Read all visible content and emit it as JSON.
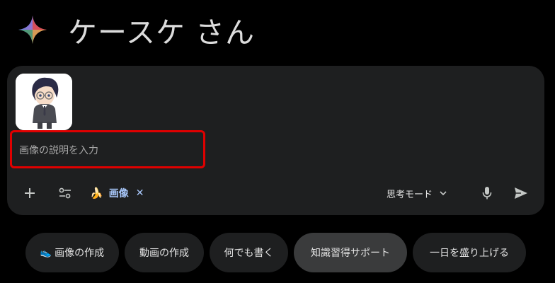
{
  "greeting": {
    "name": "ケースケ さん",
    "icon": "gemini-sparkle-icon"
  },
  "composer": {
    "attachment": {
      "icon": "anime-character-thumbnail"
    },
    "prompt": {
      "placeholder": "画像の説明を入力",
      "value": ""
    },
    "toolbar": {
      "add_icon": "plus-icon",
      "tools_icon": "tune-icon",
      "chip": {
        "emoji": "🍌",
        "label": "画像",
        "close": "✕"
      },
      "mode_label": "思考モード",
      "mode_icon": "chevron-down-icon",
      "mic_icon": "mic-icon",
      "send_icon": "send-icon"
    }
  },
  "suggestions": [
    {
      "icon": "👟",
      "label": "画像の作成",
      "active": false
    },
    {
      "icon": "",
      "label": "動画の作成",
      "active": false
    },
    {
      "icon": "",
      "label": "何でも書く",
      "active": false
    },
    {
      "icon": "",
      "label": "知識習得サポート",
      "active": true
    },
    {
      "icon": "",
      "label": "一日を盛り上げる",
      "active": false
    }
  ],
  "colors": {
    "background": "#000000",
    "surface": "#1e1f20",
    "chip_accent": "#a8c7fa",
    "highlight_border": "#e00000",
    "active_suggestion": "#3a3b3c"
  }
}
